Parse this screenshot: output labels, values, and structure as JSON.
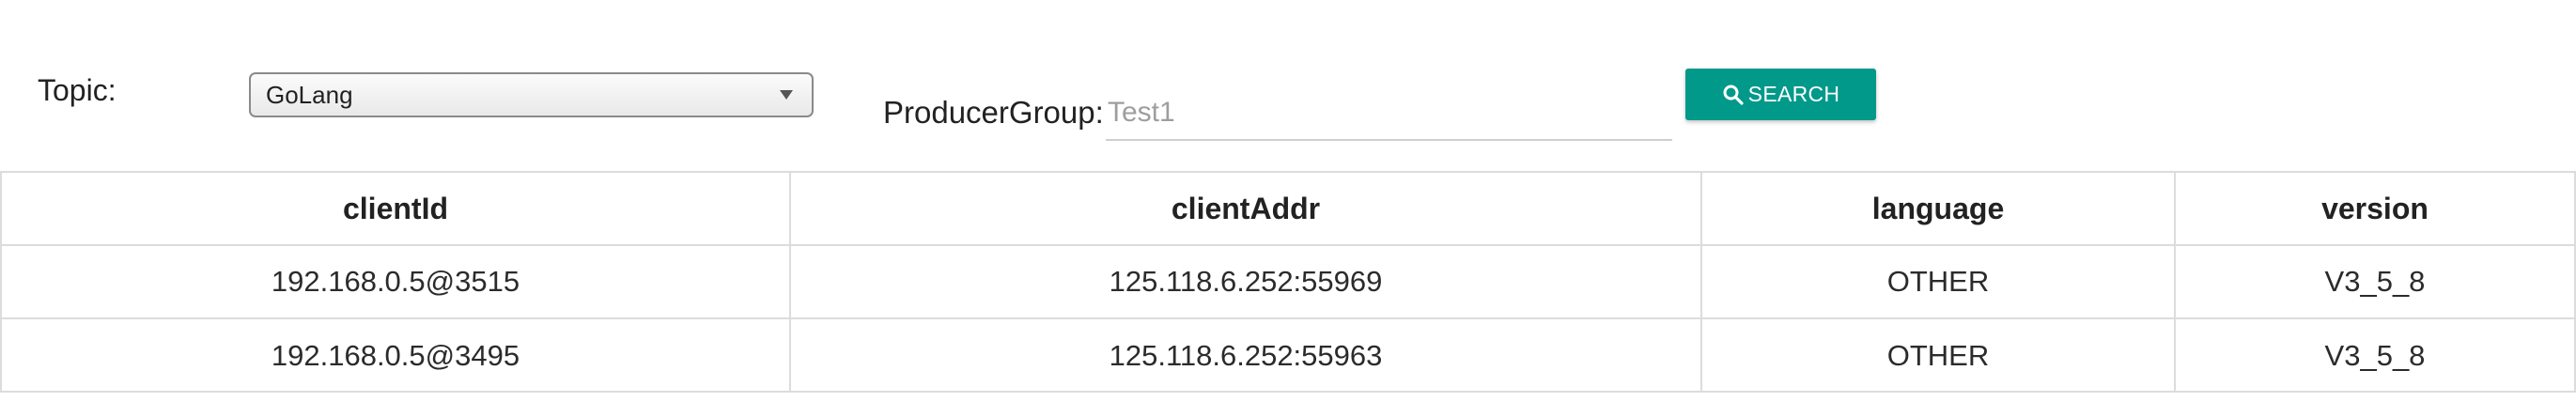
{
  "filters": {
    "topic": {
      "label": "Topic:",
      "selected": "GoLang",
      "arrow_icon": "triangle-down-icon"
    },
    "producer_group": {
      "label": "ProducerGroup:",
      "value": "",
      "placeholder": "Test1"
    },
    "search_button": {
      "label": "SEARCH",
      "icon": "search-icon",
      "color": "#00998a"
    }
  },
  "table": {
    "columns": [
      "clientId",
      "clientAddr",
      "language",
      "version"
    ],
    "rows": [
      [
        "192.168.0.5@3515",
        "125.118.6.252:55969",
        "OTHER",
        "V3_5_8"
      ],
      [
        "192.168.0.5@3495",
        "125.118.6.252:55963",
        "OTHER",
        "V3_5_8"
      ]
    ]
  }
}
